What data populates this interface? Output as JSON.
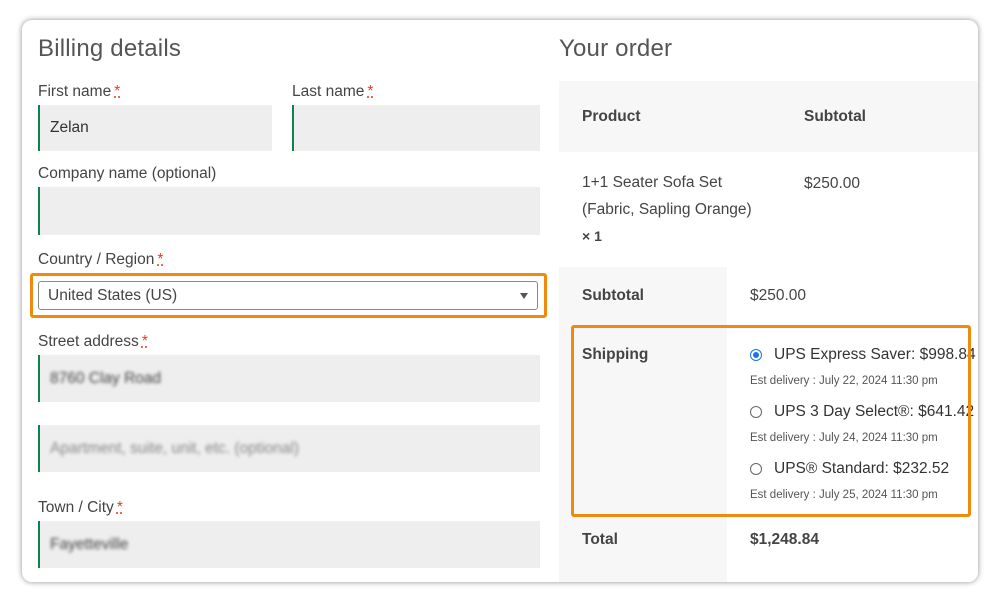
{
  "billing": {
    "heading": "Billing details",
    "required_mark": "*",
    "first_name": {
      "label": "First name",
      "value": "Zelan"
    },
    "last_name": {
      "label": "Last name",
      "value": ""
    },
    "company": {
      "label": "Company name (optional)",
      "value": ""
    },
    "country": {
      "label": "Country / Region",
      "value": "United States (US)"
    },
    "street": {
      "label": "Street address",
      "value": "8760 Clay Road",
      "placeholder2": "Apartment, suite, unit, etc. (optional)"
    },
    "city": {
      "label": "Town / City",
      "value": "Fayetteville"
    }
  },
  "order": {
    "heading": "Your order",
    "col_product": "Product",
    "col_subtotal": "Subtotal",
    "item": {
      "name_line1": "1+1 Seater Sofa Set",
      "name_line2": "(Fabric, Sapling Orange)",
      "qty": "× 1",
      "price": "$250.00"
    },
    "subtotal_label": "Subtotal",
    "subtotal_value": "$250.00",
    "shipping_label": "Shipping",
    "shipping_options": [
      {
        "label": "UPS Express Saver: $998.84",
        "est": "Est delivery : July 22, 2024 11:30 pm",
        "selected": true
      },
      {
        "label": "UPS 3 Day Select®: $641.42",
        "est": "Est delivery : July 24, 2024 11:30 pm",
        "selected": false
      },
      {
        "label": "UPS® Standard: $232.52",
        "est": "Est delivery : July 25, 2024 11:30 pm",
        "selected": false
      }
    ],
    "total_label": "Total",
    "total_value": "$1,248.84"
  },
  "colors": {
    "highlight": "#f08a0c",
    "field_accent": "#0f834d",
    "required": "#e2401c",
    "radio_selected": "#1a73e8"
  }
}
